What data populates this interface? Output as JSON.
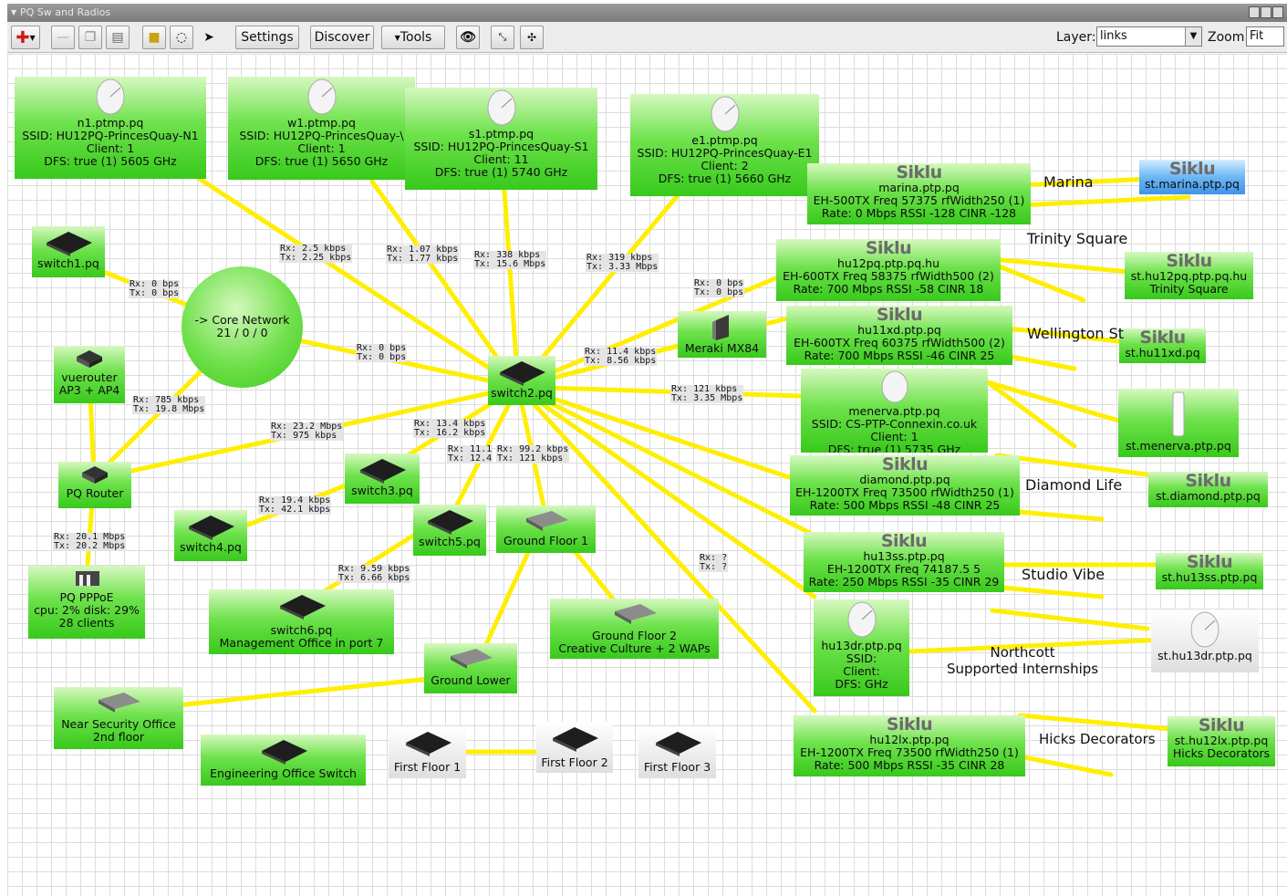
{
  "window": {
    "title": "PQ Sw and Radios"
  },
  "toolbar": {
    "settings_label": "Settings",
    "discover_label": "Discover",
    "tools_label": "Tools",
    "layer_label": "Layer:",
    "layer_value": "links",
    "zoom_label": "Zoom:",
    "zoom_value": "Fit"
  },
  "icons": [
    "add-icon",
    "minus-icon",
    "copy-icon",
    "paste-icon",
    "lock-icon",
    "lasso-icon",
    "pointer-icon",
    "binoculars-icon",
    "collapse-icon",
    "expand-icon"
  ],
  "colors": {
    "device": "#46cd26",
    "selected": "#4a9fe8",
    "link": "#ffee00",
    "offline": "#e6e6e6"
  },
  "nodes": {
    "n1": [
      "n1.ptmp.pq",
      "SSID: HU12PQ-PrincesQuay-N1",
      "Client: 1",
      "DFS: true (1) 5605 GHz"
    ],
    "w1": [
      "w1.ptmp.pq",
      "SSID: HU12PQ-PrincesQuay-\\",
      "Client: 1",
      "DFS: true (1) 5650 GHz"
    ],
    "s1": [
      "s1.ptmp.pq",
      "SSID: HU12PQ-PrincesQuay-S1",
      "Client: 11",
      "DFS: true (1) 5740 GHz"
    ],
    "e1": [
      "e1.ptmp.pq",
      "SSID: HU12PQ-PrincesQuay-E1",
      "Client: 2",
      "DFS: true (1) 5660 GHz"
    ],
    "marina": [
      "marina.ptp.pq",
      "EH-500TX Freq 57375 rfWidth250 (1)",
      "Rate: 0 Mbps RSSI -128 CINR -128"
    ],
    "st_marina": [
      "st.marina.ptp.pq"
    ],
    "hu12pq": [
      "hu12pq.ptp.pq.hu",
      "EH-600TX Freq 58375 rfWidth500 (2)",
      "Rate: 700 Mbps RSSI -58 CINR 18"
    ],
    "st_hu12pq": [
      "st.hu12pq.ptp.pq.hu",
      "Trinity Square"
    ],
    "hu11xd": [
      "hu11xd.ptp.pq",
      "EH-600TX Freq 60375 rfWidth500 (2)",
      "Rate: 700 Mbps RSSI -46 CINR 25"
    ],
    "st_hu11xd": [
      "st.hu11xd.pq"
    ],
    "menerva": [
      "menerva.ptp.pq",
      "SSID: CS-PTP-Connexin.co.uk",
      "Client: 1",
      "DFS: true (1) 5735 GHz"
    ],
    "st_menerva": [
      "st.menerva.ptp.pq"
    ],
    "diamond": [
      "diamond.ptp.pq",
      "EH-1200TX Freq 73500 rfWidth250 (1)",
      "Rate: 500 Mbps RSSI -48 CINR 25"
    ],
    "st_diamond": [
      "st.diamond.ptp.pq"
    ],
    "hu13ss": [
      "hu13ss.ptp.pq",
      "EH-1200TX Freq 74187.5 5",
      "Rate: 250 Mbps RSSI -35 CINR 29"
    ],
    "st_hu13ss": [
      "st.hu13ss.ptp.pq"
    ],
    "hu13dr": [
      "hu13dr.ptp.pq",
      "SSID:",
      "Client:",
      "DFS:   GHz"
    ],
    "st_hu13dr": [
      "st.hu13dr.ptp.pq"
    ],
    "hu12lx": [
      "hu12lx.ptp.pq",
      "EH-1200TX Freq 73500 rfWidth250 (1)",
      "Rate: 500 Mbps RSSI -35 CINR 28"
    ],
    "st_hu12lx": [
      "st.hu12lx.ptp.pq",
      "Hicks Decorators"
    ],
    "switch1": [
      "switch1.pq"
    ],
    "core": [
      "-> Core Network",
      "21 / 0 / 0"
    ],
    "switch2": [
      "switch2.pq"
    ],
    "meraki": [
      "Meraki MX84"
    ],
    "vuerouter": [
      "vuerouter",
      "AP3 + AP4"
    ],
    "pqrouter": [
      "PQ Router"
    ],
    "switch3": [
      "switch3.pq"
    ],
    "switch4": [
      "switch4.pq"
    ],
    "switch5": [
      "switch5.pq"
    ],
    "groundfloor1": [
      "Ground Floor 1"
    ],
    "pppoe": [
      "PQ PPPoE",
      "cpu: 2% disk: 29%",
      "28 clients"
    ],
    "switch6": [
      "switch6.pq",
      "Management Office in port 7"
    ],
    "groundfloor2": [
      "Ground Floor 2",
      "Creative Culture + 2 WAPs"
    ],
    "groundlower": [
      "Ground Lower"
    ],
    "nearsecurity": [
      "Near Security Office",
      "2nd floor"
    ],
    "engineering": [
      "Engineering Office Switch"
    ],
    "firstfloor1": [
      "First Floor 1"
    ],
    "firstfloor2": [
      "First Floor 2"
    ],
    "firstfloor3": [
      "First Floor 3"
    ]
  },
  "siklu_brand": "Siklu",
  "labels": {
    "marina": "Marina",
    "trinity": "Trinity Square",
    "wellington": "Wellington St",
    "diamond": "Diamond Life",
    "studio": "Studio Vibe",
    "northcott": [
      "Northcott",
      "Supported Internships"
    ],
    "hicks": "Hicks Decorators"
  },
  "traffic": [
    [
      "Rx: 2.5 kbps",
      "Tx: 2.25 kbps"
    ],
    [
      "Rx: 1.07 kbps",
      "Tx: 1.77 kbps"
    ],
    [
      "Rx: 338 kbps",
      "Tx: 15.6 Mbps"
    ],
    [
      "Rx: 319 kbps",
      "Tx: 3.33 Mbps"
    ],
    [
      "Rx: 0 bps",
      "Tx: 0 bps"
    ],
    [
      "Rx: 0 bps",
      "Tx: 0 bps"
    ],
    [
      "Rx: 0 bps",
      "Tx: 0 bps"
    ],
    [
      "Rx: 11.4 kbps",
      "Tx: 8.56 kbps"
    ],
    [
      "Rx: 121 kbps",
      "Tx: 3.35 Mbps"
    ],
    [
      "Rx: 785 kbps",
      "Tx: 19.8 Mbps"
    ],
    [
      "Rx: 23.2 Mbps",
      "Tx: 975 kbps"
    ],
    [
      "Rx: 13.4 kbps",
      "Tx: 16.2 kbps"
    ],
    [
      "Rx: 11.1",
      "Tx: 12.4"
    ],
    [
      "Rx: 99.2 kbps",
      "Tx: 121 kbps"
    ],
    [
      "Rx: 19.4 kbps",
      "Tx: 42.1 kbps"
    ],
    [
      "Rx: 20.1 Mbps",
      "Tx: 20.2 Mbps"
    ],
    [
      "Rx: 9.59 kbps",
      "Tx: 6.66 kbps"
    ],
    [
      "Rx: ?",
      "Tx: ?"
    ]
  ]
}
